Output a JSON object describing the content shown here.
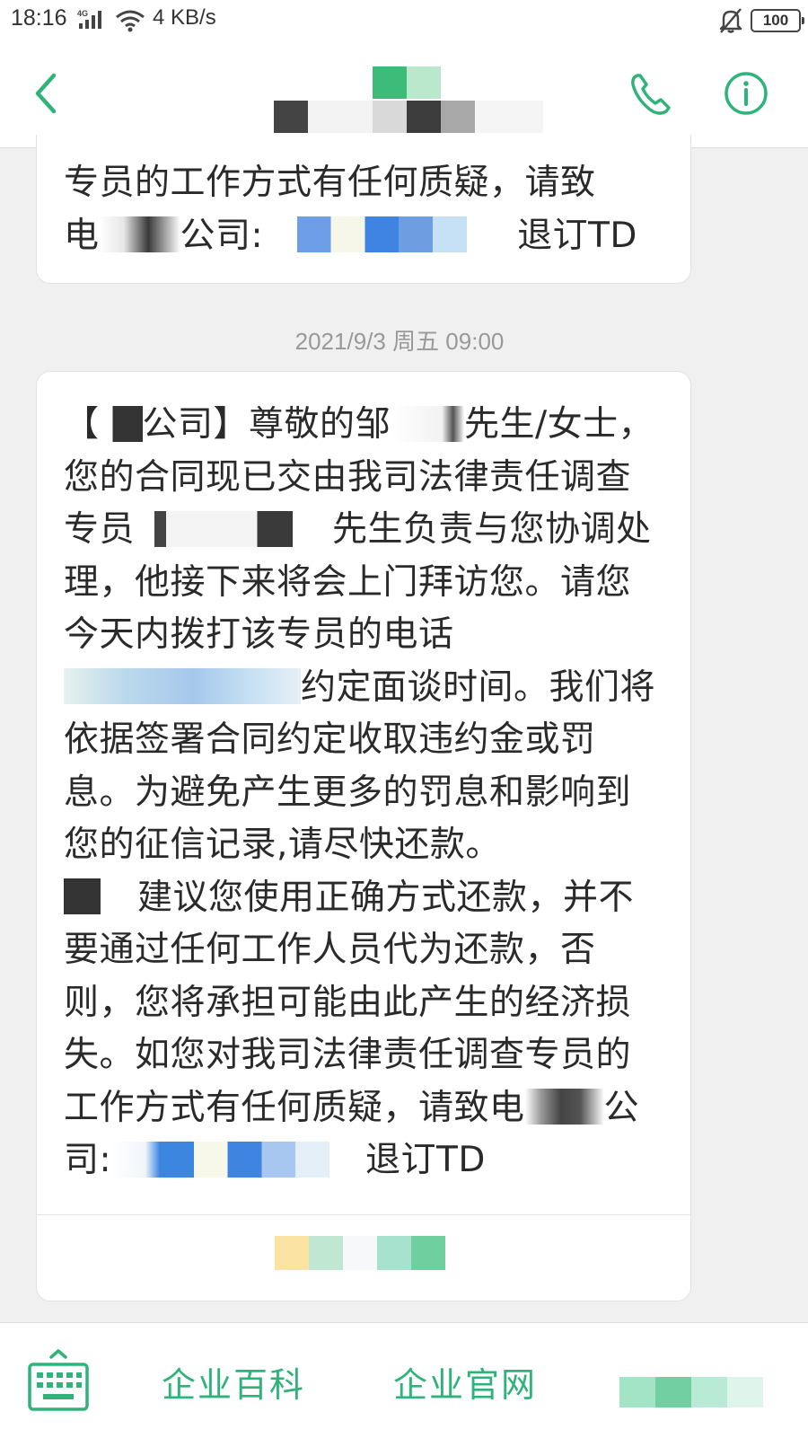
{
  "status_bar": {
    "time": "18:16",
    "network": "4G",
    "speed": "4 KB/s",
    "battery": "100"
  },
  "header": {
    "contact_name": "",
    "back_icon": "chevron-left-icon",
    "phone_icon": "phone-icon",
    "info_icon": "info-icon"
  },
  "messages": [
    {
      "text_1": "专员的工作方式有任何质疑，请致",
      "text_2a": "电",
      "text_2b": "公司:",
      "text_2c": "退订TD"
    },
    {
      "timestamp": "2021/9/3 周五 09:00",
      "p1": "【",
      "p2": "公司】尊敬的邹",
      "p3": "先生/女士，您的合同现已交由我司法律责任调查专员",
      "p4": "先生负责与您协调处理，他接下来将会上门拜访您。请您今天内拨打该专员的电话",
      "p5": "约定面谈时间。我们将依据签署合同约定收取违约金或罚息。为避免产生更多的罚息和影响到您的征信记录,请尽快还款。",
      "p6": "建议您使用正确方式还款，并不要通过任何工作人员代为还款，否则，您将承担可能由此产生的经济损失。如您对我司法律责任调查专员的工作方式有任何质疑，请致电",
      "p7": "公司:",
      "p8": "退订TD"
    }
  ],
  "bottom_bar": {
    "keyboard_icon": "keyboard-icon",
    "link_1": "企业百科",
    "link_2": "企业官网"
  },
  "colors": {
    "accent": "#2fb37a",
    "background": "#f0f0f0",
    "bubble": "#ffffff"
  }
}
